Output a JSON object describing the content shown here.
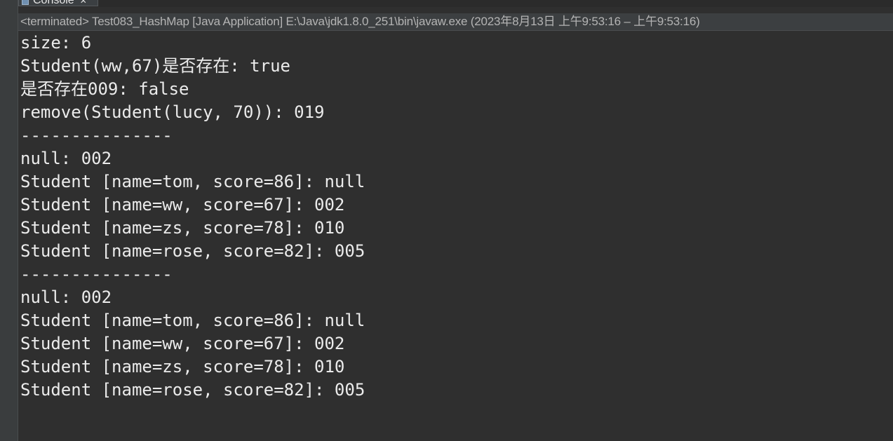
{
  "tab": {
    "label": "Console",
    "close_glyph": "✕"
  },
  "status": {
    "text": "<terminated> Test083_HashMap [Java Application] E:\\Java\\jdk1.8.0_251\\bin\\javaw.exe  (2023年8月13日 上午9:53:16 – 上午9:53:16)"
  },
  "output": {
    "lines": [
      "size: 6",
      "Student(ww,67)是否存在: true",
      "是否存在009: false",
      "remove(Student(lucy, 70)): 019",
      "---------------",
      "null: 002",
      "Student [name=tom, score=86]: null",
      "Student [name=ww, score=67]: 002",
      "Student [name=zs, score=78]: 010",
      "Student [name=rose, score=82]: 005",
      "---------------",
      "null: 002",
      "Student [name=tom, score=86]: null",
      "Student [name=ww, score=67]: 002",
      "Student [name=zs, score=78]: 010",
      "Student [name=rose, score=82]: 005"
    ]
  },
  "colors": {
    "background": "#2f2f2f",
    "text": "#ebebeb",
    "status_text": "#b4b4b4"
  },
  "icons": {
    "tab_icon": "console-icon",
    "close_icon": "close-icon"
  }
}
